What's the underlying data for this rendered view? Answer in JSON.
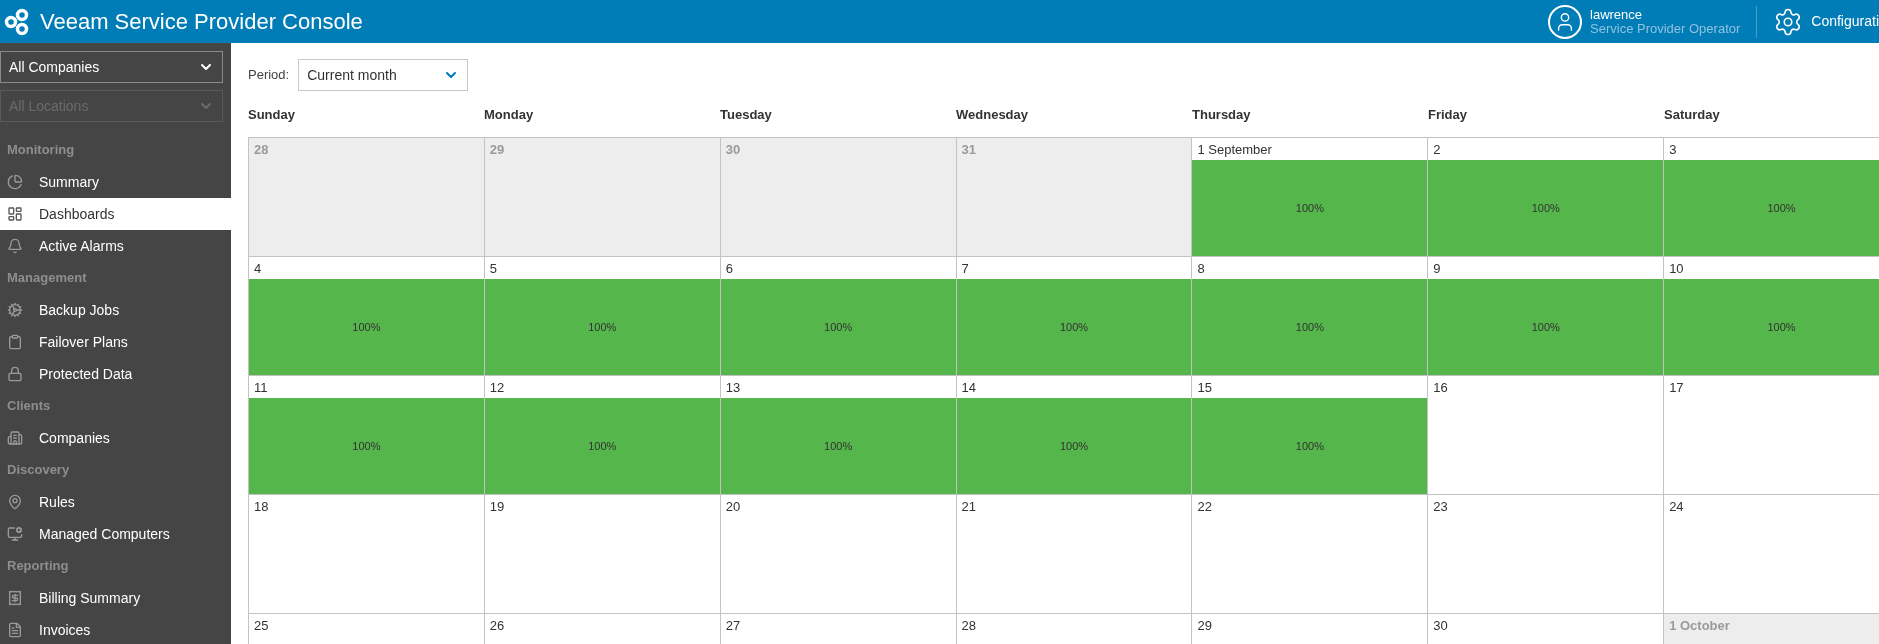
{
  "header": {
    "title": "Veeam Service Provider Console",
    "user": {
      "name": "lawrence",
      "role": "Service Provider Operator"
    },
    "configuration": "Configurati"
  },
  "sidebar": {
    "company_select": {
      "value": "All Companies",
      "disabled": false
    },
    "location_select": {
      "value": "All Locations",
      "disabled": true
    },
    "sections": [
      {
        "title": "Monitoring",
        "items": [
          {
            "label": "Summary",
            "selected": false
          },
          {
            "label": "Dashboards",
            "selected": true
          },
          {
            "label": "Active Alarms",
            "selected": false
          }
        ]
      },
      {
        "title": "Management",
        "items": [
          {
            "label": "Backup Jobs",
            "selected": false
          },
          {
            "label": "Failover Plans",
            "selected": false
          },
          {
            "label": "Protected Data",
            "selected": false
          }
        ]
      },
      {
        "title": "Clients",
        "items": [
          {
            "label": "Companies",
            "selected": false
          }
        ]
      },
      {
        "title": "Discovery",
        "items": [
          {
            "label": "Rules",
            "selected": false
          },
          {
            "label": "Managed Computers",
            "selected": false
          }
        ]
      },
      {
        "title": "Reporting",
        "items": [
          {
            "label": "Billing Summary",
            "selected": false
          },
          {
            "label": "Invoices",
            "selected": false
          }
        ]
      }
    ]
  },
  "period": {
    "label": "Period:",
    "value": "Current month"
  },
  "calendar": {
    "weekdays": [
      "Sunday",
      "Monday",
      "Tuesday",
      "Wednesday",
      "Thursday",
      "Friday",
      "Saturday"
    ],
    "weeks": [
      [
        {
          "label": "28",
          "in_month": false
        },
        {
          "label": "29",
          "in_month": false
        },
        {
          "label": "30",
          "in_month": false
        },
        {
          "label": "31",
          "in_month": false
        },
        {
          "label": "1 September",
          "in_month": true,
          "percent": "100%"
        },
        {
          "label": "2",
          "in_month": true,
          "percent": "100%"
        },
        {
          "label": "3",
          "in_month": true,
          "percent": "100%"
        }
      ],
      [
        {
          "label": "4",
          "in_month": true,
          "percent": "100%"
        },
        {
          "label": "5",
          "in_month": true,
          "percent": "100%"
        },
        {
          "label": "6",
          "in_month": true,
          "percent": "100%"
        },
        {
          "label": "7",
          "in_month": true,
          "percent": "100%"
        },
        {
          "label": "8",
          "in_month": true,
          "percent": "100%"
        },
        {
          "label": "9",
          "in_month": true,
          "percent": "100%"
        },
        {
          "label": "10",
          "in_month": true,
          "percent": "100%"
        }
      ],
      [
        {
          "label": "11",
          "in_month": true,
          "percent": "100%"
        },
        {
          "label": "12",
          "in_month": true,
          "percent": "100%"
        },
        {
          "label": "13",
          "in_month": true,
          "percent": "100%"
        },
        {
          "label": "14",
          "in_month": true,
          "percent": "100%"
        },
        {
          "label": "15",
          "in_month": true,
          "percent": "100%"
        },
        {
          "label": "16",
          "in_month": true
        },
        {
          "label": "17",
          "in_month": true
        }
      ],
      [
        {
          "label": "18",
          "in_month": true
        },
        {
          "label": "19",
          "in_month": true
        },
        {
          "label": "20",
          "in_month": true
        },
        {
          "label": "21",
          "in_month": true
        },
        {
          "label": "22",
          "in_month": true
        },
        {
          "label": "23",
          "in_month": true
        },
        {
          "label": "24",
          "in_month": true
        }
      ],
      [
        {
          "label": "25",
          "in_month": true
        },
        {
          "label": "26",
          "in_month": true
        },
        {
          "label": "27",
          "in_month": true
        },
        {
          "label": "28",
          "in_month": true
        },
        {
          "label": "29",
          "in_month": true
        },
        {
          "label": "30",
          "in_month": true
        },
        {
          "label": "1 October",
          "in_month": false
        }
      ]
    ]
  }
}
